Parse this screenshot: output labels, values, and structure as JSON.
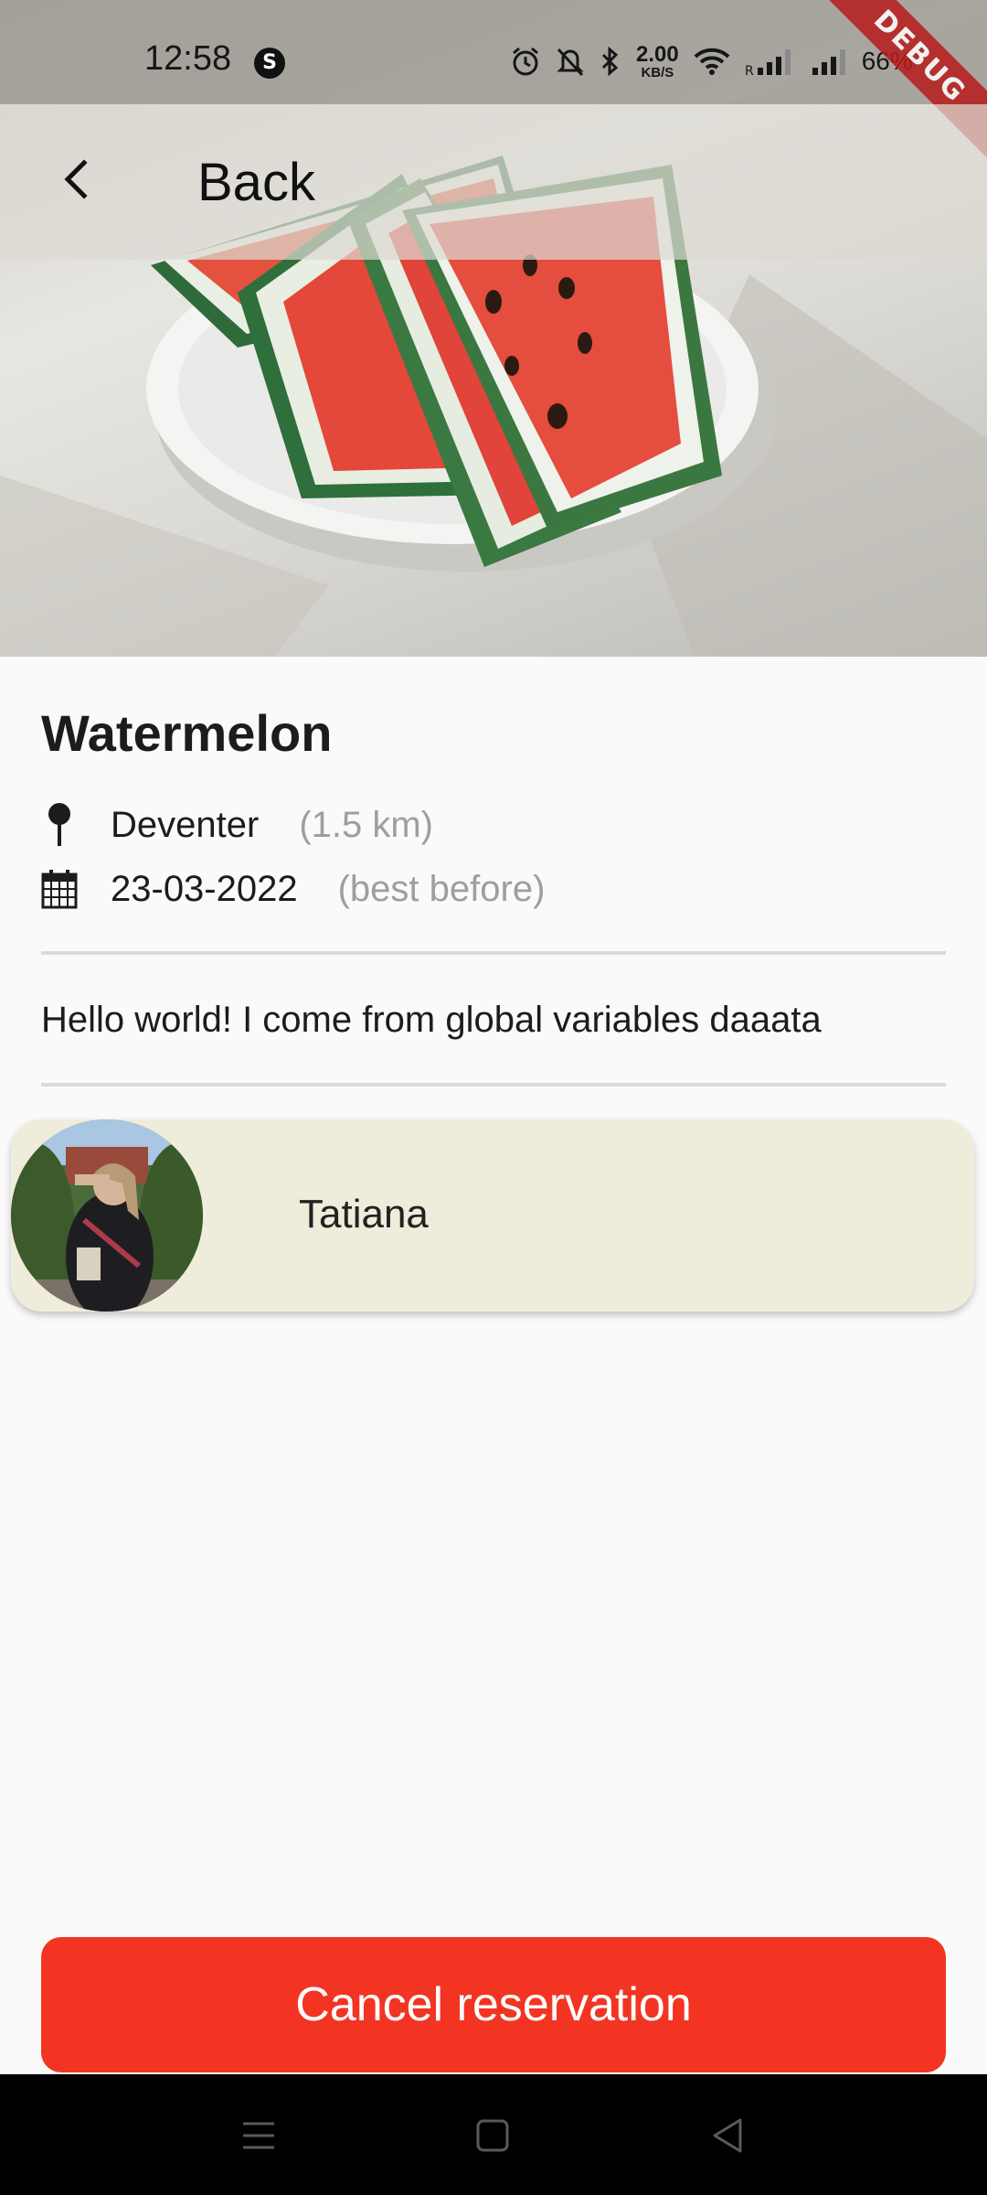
{
  "status_bar": {
    "time": "12:58",
    "net_speed_value": "2.00",
    "net_speed_unit": "KB/S",
    "battery": "66%",
    "icons": [
      "s-app-icon",
      "alarm-icon",
      "silent-icon",
      "bluetooth-icon",
      "wifi-icon",
      "signal-roaming-icon",
      "signal-icon",
      "battery-charging-icon"
    ]
  },
  "debug_banner": "DEBUG",
  "app_bar": {
    "back_label": "Back",
    "back_icon": "chevron-left-icon"
  },
  "product": {
    "title": "Watermelon",
    "location": "Deventer",
    "distance": "(1.5 km)",
    "date": "23-03-2022",
    "date_note": "(best before)",
    "description": "Hello world! I come from global variables daaata"
  },
  "owner": {
    "name": "Tatiana"
  },
  "actions": {
    "cancel_label": "Cancel reservation"
  },
  "colors": {
    "accent_red": "#f33423",
    "card_bg": "#efecdb",
    "muted_text": "#9e9e9e"
  }
}
